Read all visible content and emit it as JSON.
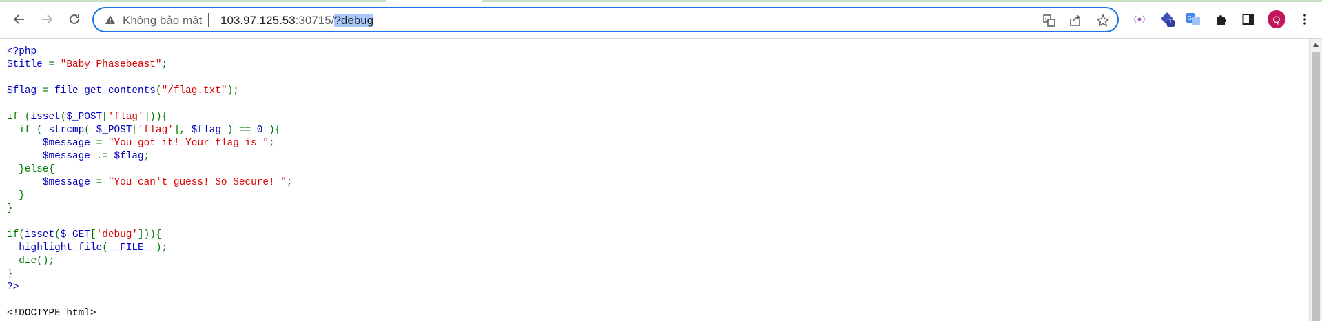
{
  "browser": {
    "omnibox": {
      "security_label": "Không bảo mật",
      "url_host": "103.97.125.53",
      "url_port": ":30715/",
      "url_query": "?debug"
    },
    "profile_initial": "Q",
    "extension_badge": "1",
    "icons": [
      "back-icon",
      "forward-icon",
      "reload-icon",
      "warning-icon",
      "translate-icon",
      "share-icon",
      "star-icon",
      "cast-icon",
      "extension-icon",
      "translate-extension-icon",
      "puzzle-icon",
      "side-panel-icon",
      "more-icon"
    ]
  },
  "colors": {
    "default": "#0000bb",
    "keyword": "#007700",
    "string": "#dd0000",
    "html": "#000000",
    "accent": "#1a73e8",
    "avatar": "#c2185b"
  },
  "code_lines": [
    [
      {
        "t": "default",
        "v": "<?php"
      }
    ],
    [
      {
        "t": "default",
        "v": "$title "
      },
      {
        "t": "keyword",
        "v": "= "
      },
      {
        "t": "string",
        "v": "\"Baby Phasebeast\""
      },
      {
        "t": "keyword",
        "v": ";"
      }
    ],
    [],
    [
      {
        "t": "default",
        "v": "$flag "
      },
      {
        "t": "keyword",
        "v": "= "
      },
      {
        "t": "default",
        "v": "file_get_contents"
      },
      {
        "t": "keyword",
        "v": "("
      },
      {
        "t": "string",
        "v": "\"/flag.txt\""
      },
      {
        "t": "keyword",
        "v": ");"
      }
    ],
    [],
    [
      {
        "t": "keyword",
        "v": "if ("
      },
      {
        "t": "default",
        "v": "isset"
      },
      {
        "t": "keyword",
        "v": "("
      },
      {
        "t": "default",
        "v": "$_POST"
      },
      {
        "t": "keyword",
        "v": "["
      },
      {
        "t": "string",
        "v": "'flag'"
      },
      {
        "t": "keyword",
        "v": "])){"
      }
    ],
    [
      {
        "t": "keyword",
        "v": "  if ( "
      },
      {
        "t": "default",
        "v": "strcmp"
      },
      {
        "t": "keyword",
        "v": "( "
      },
      {
        "t": "default",
        "v": "$_POST"
      },
      {
        "t": "keyword",
        "v": "["
      },
      {
        "t": "string",
        "v": "'flag'"
      },
      {
        "t": "keyword",
        "v": "], "
      },
      {
        "t": "default",
        "v": "$flag "
      },
      {
        "t": "keyword",
        "v": ") == "
      },
      {
        "t": "default",
        "v": "0 "
      },
      {
        "t": "keyword",
        "v": "){"
      }
    ],
    [
      {
        "t": "keyword",
        "v": "      "
      },
      {
        "t": "default",
        "v": "$message "
      },
      {
        "t": "keyword",
        "v": "= "
      },
      {
        "t": "string",
        "v": "\"You got it! Your flag is \""
      },
      {
        "t": "keyword",
        "v": ";"
      }
    ],
    [
      {
        "t": "keyword",
        "v": "      "
      },
      {
        "t": "default",
        "v": "$message "
      },
      {
        "t": "keyword",
        "v": ".= "
      },
      {
        "t": "default",
        "v": "$flag"
      },
      {
        "t": "keyword",
        "v": ";"
      }
    ],
    [
      {
        "t": "keyword",
        "v": "  }else{"
      }
    ],
    [
      {
        "t": "keyword",
        "v": "      "
      },
      {
        "t": "default",
        "v": "$message "
      },
      {
        "t": "keyword",
        "v": "= "
      },
      {
        "t": "string",
        "v": "\"You can't guess! So Secure! \""
      },
      {
        "t": "keyword",
        "v": ";"
      }
    ],
    [
      {
        "t": "keyword",
        "v": "  }"
      }
    ],
    [
      {
        "t": "keyword",
        "v": "}"
      }
    ],
    [],
    [
      {
        "t": "keyword",
        "v": "if("
      },
      {
        "t": "default",
        "v": "isset"
      },
      {
        "t": "keyword",
        "v": "("
      },
      {
        "t": "default",
        "v": "$_GET"
      },
      {
        "t": "keyword",
        "v": "["
      },
      {
        "t": "string",
        "v": "'debug'"
      },
      {
        "t": "keyword",
        "v": "])){"
      }
    ],
    [
      {
        "t": "keyword",
        "v": "  "
      },
      {
        "t": "default",
        "v": "highlight_file"
      },
      {
        "t": "keyword",
        "v": "("
      },
      {
        "t": "default",
        "v": "__FILE__"
      },
      {
        "t": "keyword",
        "v": ");"
      }
    ],
    [
      {
        "t": "keyword",
        "v": "  die();"
      }
    ],
    [
      {
        "t": "keyword",
        "v": "}"
      }
    ],
    [
      {
        "t": "default",
        "v": "?>"
      }
    ],
    [],
    [
      {
        "t": "html",
        "v": "<!DOCTYPE html>"
      }
    ]
  ]
}
